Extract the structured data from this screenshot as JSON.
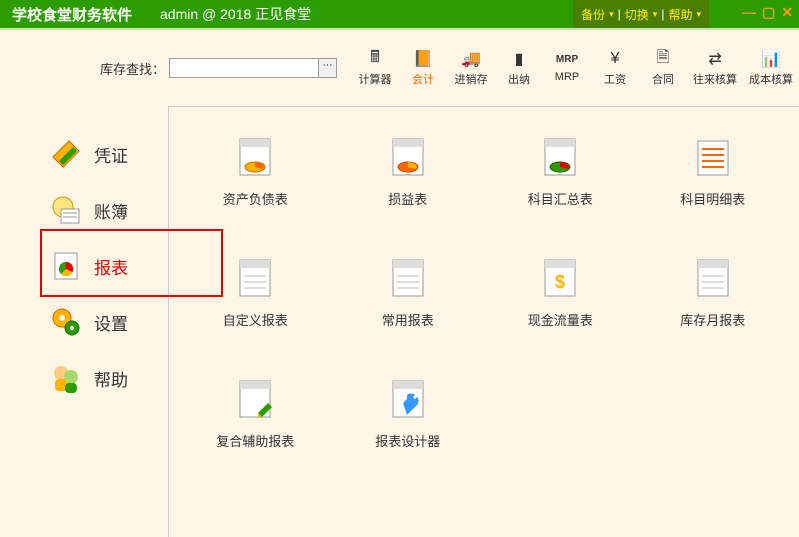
{
  "titlebar": {
    "app_title": "学校食堂财务软件",
    "user_info": "admin @ 2018 正见食堂",
    "links": {
      "backup": "备份",
      "switch": "切换",
      "help": "帮助"
    }
  },
  "search": {
    "label": "库存查找：",
    "placeholder": ""
  },
  "toolbar": [
    {
      "key": "calc",
      "label": "计算器"
    },
    {
      "key": "acct",
      "label": "会计",
      "active": true
    },
    {
      "key": "inv",
      "label": "进销存"
    },
    {
      "key": "cash",
      "label": "出纳"
    },
    {
      "key": "mrp",
      "label": "MRP"
    },
    {
      "key": "salary",
      "label": "工资"
    },
    {
      "key": "contract",
      "label": "合同"
    },
    {
      "key": "recv",
      "label": "往来核算"
    },
    {
      "key": "cost",
      "label": "成本核算"
    }
  ],
  "sidebar": [
    {
      "key": "voucher",
      "label": "凭证"
    },
    {
      "key": "ledger",
      "label": "账簿"
    },
    {
      "key": "report",
      "label": "报表",
      "selected": true
    },
    {
      "key": "settings",
      "label": "设置"
    },
    {
      "key": "help",
      "label": "帮助"
    }
  ],
  "grid": [
    {
      "key": "balance_sheet",
      "label": "资产负债表"
    },
    {
      "key": "income",
      "label": "损益表"
    },
    {
      "key": "subject_summary",
      "label": "科目汇总表"
    },
    {
      "key": "subject_detail",
      "label": "科目明细表"
    },
    {
      "key": "custom",
      "label": "自定义报表"
    },
    {
      "key": "common",
      "label": "常用报表"
    },
    {
      "key": "cashflow",
      "label": "现金流量表"
    },
    {
      "key": "stock_month",
      "label": "库存月报表"
    },
    {
      "key": "composite",
      "label": "复合辅助报表"
    },
    {
      "key": "designer",
      "label": "报表设计器"
    }
  ]
}
